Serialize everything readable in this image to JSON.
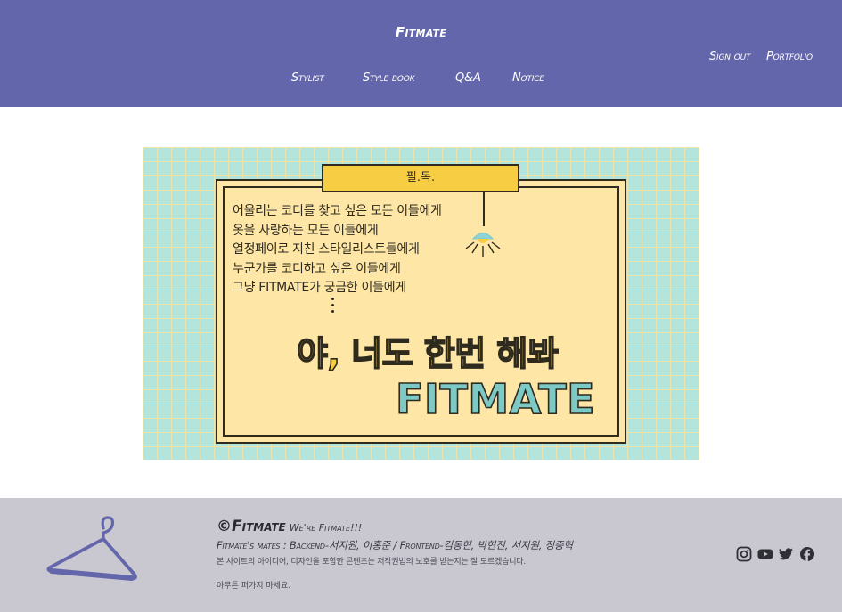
{
  "header": {
    "brand": "Fitmate",
    "nav": [
      {
        "label": "Stylist"
      },
      {
        "label": "Style book"
      },
      {
        "label": "Q&A"
      },
      {
        "label": "Notice"
      }
    ],
    "auth": {
      "sign_out": "Sign out",
      "portfolio": "Portfolio"
    }
  },
  "banner": {
    "tag": "필.독.",
    "lines": [
      "어울리는 코디를 찾고 싶은 모든 이들에게",
      "옷을 사랑하는 모든 이들에게",
      "열정페이로 지친 스타일리스트들에게",
      "누군가를 코디하고 싶은 이들에게",
      "그냥 FITMATE가 궁금한 이들에게"
    ],
    "headline": "야, 너도 한번 해봐",
    "logo_text": "FITMATE"
  },
  "footer": {
    "brand": "©Fitmate",
    "slogan": "We're Fitmate!!!",
    "team": "Fitmate's mates : Backend-서지원, 이홍준 / Frontend-김동현, 박현진, 서지원, 정종혁",
    "copyright_note": "본 사이트의 아이디어, 디자인을 포함한 콘텐츠는 저작권법의 보호를 받는지는 잘 모르겠습니다.",
    "note": "아무튼 퍼가지 마세요.",
    "social": [
      "instagram-icon",
      "youtube-icon",
      "twitter-icon",
      "facebook-icon"
    ]
  },
  "colors": {
    "header_bg": "#6466ab",
    "footer_bg": "#c9c7d0",
    "banner_bg": "#b3e5dc",
    "board": "#fde6a6",
    "accent_yellow": "#f7cd44",
    "accent_teal": "#7cc9c6"
  }
}
